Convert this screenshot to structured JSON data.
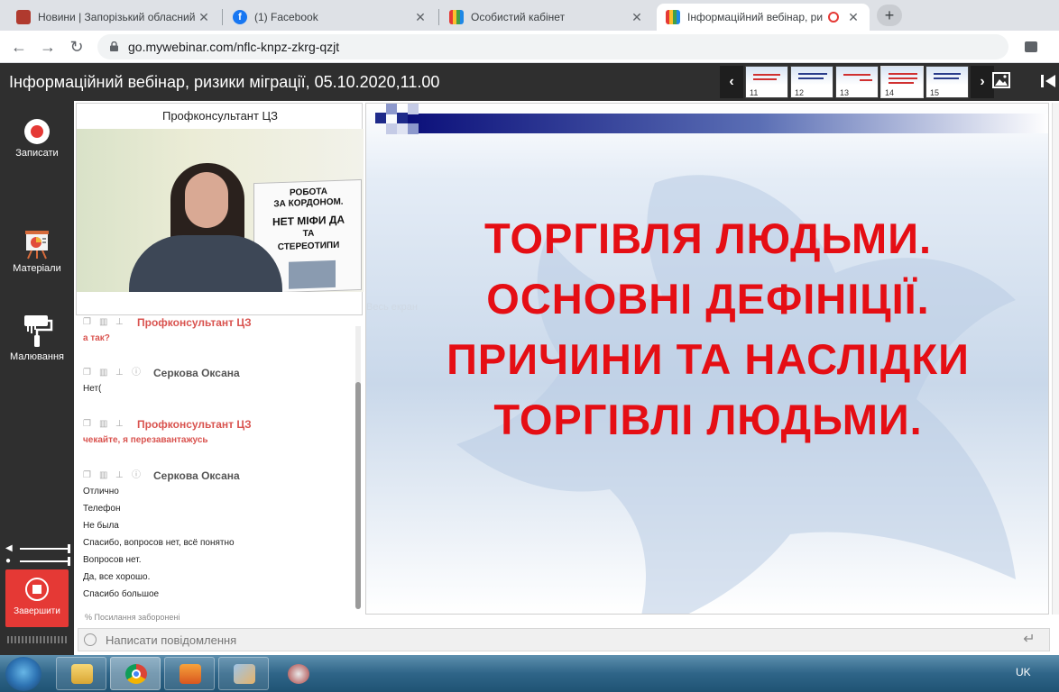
{
  "browser": {
    "tabs": [
      {
        "title": "Новини | Запорізький обласний",
        "icon": "zoda-icon",
        "icon_color": "#b03a2e"
      },
      {
        "title": "(1) Facebook",
        "icon": "facebook-icon",
        "icon_color": "#1877f2"
      },
      {
        "title": "Особистий кабінет",
        "icon": "mywebinar-icon",
        "icon_color": "#3a3a3a"
      },
      {
        "title": "Інформаційний вебінар, ри",
        "icon": "mywebinar-icon",
        "icon_color": "#3a3a3a",
        "active": true
      }
    ],
    "url": "go.mywebinar.com/nflc-knpz-zkrg-qzjt"
  },
  "header": {
    "title": "Інформаційний вебінар, ризики міграції, 05.10.2020,11.00",
    "thumbnails": [
      "11",
      "12",
      "13",
      "14",
      "15"
    ],
    "active_thumbnail": "14",
    "prev_arrow": "‹",
    "next_arrow": "›"
  },
  "sidebar": {
    "record_label": "Записати",
    "materials_label": "Матеріали",
    "drawing_label": "Малювання",
    "finish_label": "Завершити"
  },
  "video": {
    "label": "Профконсультант ЦЗ",
    "poster_lines": [
      "РОБОТА",
      "ЗА КОРДОНОМ.",
      "НЕТ МІФИ ДА",
      "ТА",
      "СТЕРЕОТИПИ"
    ]
  },
  "chat": {
    "messages": [
      {
        "author": "Профконсультант ЦЗ",
        "red": true,
        "lines": [
          "а так?"
        ]
      },
      {
        "author": "Серкова Оксана",
        "red": false,
        "lines": [
          "Нет("
        ]
      },
      {
        "author": "Профконсультант ЦЗ",
        "red": true,
        "lines": [
          "чекайте, я перезавантажусь"
        ]
      },
      {
        "author": "Серкова Оксана",
        "red": false,
        "lines": [
          "Отлично",
          "Телефон",
          "Не была",
          "Спасибо, вопросов нет, всё понятно",
          "Вопросов нет.",
          "Да, все хорошо.",
          "Спасибо большое"
        ]
      }
    ],
    "links_note": "Посилання заборонені",
    "composer_placeholder": "Написати повідомлення"
  },
  "slide": {
    "lines": [
      "ТОРГІВЛЯ ЛЮДЬМИ.",
      "ОСНОВНІ ДЕФІНІЦІЇ.",
      "ПРИЧИНИ ТА НАСЛІДКИ",
      "ТОРГІВЛІ ЛЮДЬМИ."
    ],
    "text_color": "#e50e14",
    "fullscreen_hint": "Весь екран"
  },
  "taskbar": {
    "language": "UK",
    "apps": [
      "explorer-icon",
      "chrome-icon",
      "media-player-icon",
      "paint-icon",
      "snipping-tool-icon"
    ]
  }
}
